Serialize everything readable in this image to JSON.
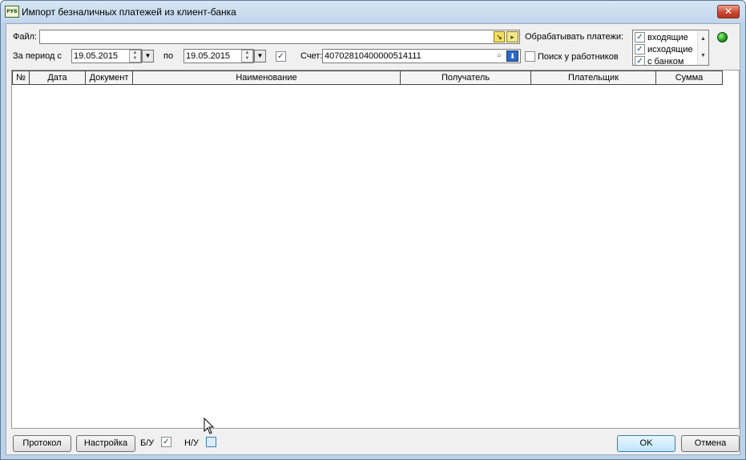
{
  "window": {
    "title": "Импорт безналичных платежей из клиент-банка",
    "icon_text": "РУБ",
    "close_glyph": "✕"
  },
  "file": {
    "label": "Файл:",
    "value": ""
  },
  "period": {
    "from_label": "За период с",
    "from_value": "19.05.2015",
    "to_label": "по",
    "to_value": "19.05.2015",
    "enabled": true
  },
  "account": {
    "label": "Счет:",
    "value": "40702810400000514111"
  },
  "process": {
    "label": "Обрабатывать платежи:",
    "options": [
      {
        "label": "входящие",
        "checked": true
      },
      {
        "label": "исходящие",
        "checked": true
      },
      {
        "label": "с банком",
        "checked": true
      }
    ]
  },
  "search_employees": {
    "label": "Поиск у работников",
    "checked": false
  },
  "grid": {
    "columns": [
      "№",
      "Дата",
      "Документ",
      "Наименование",
      "Получатель",
      "Плательщик",
      "Сумма"
    ]
  },
  "footer": {
    "protocol": "Протокол",
    "settings": "Настройка",
    "bu_label": "Б/У",
    "bu_checked": true,
    "nu_label": "Н/У",
    "nu_checked": false,
    "ok": "OK",
    "cancel": "Отмена"
  },
  "colors": {
    "status_indicator": "#1d9a1d",
    "accent": "#3c7fb1"
  }
}
